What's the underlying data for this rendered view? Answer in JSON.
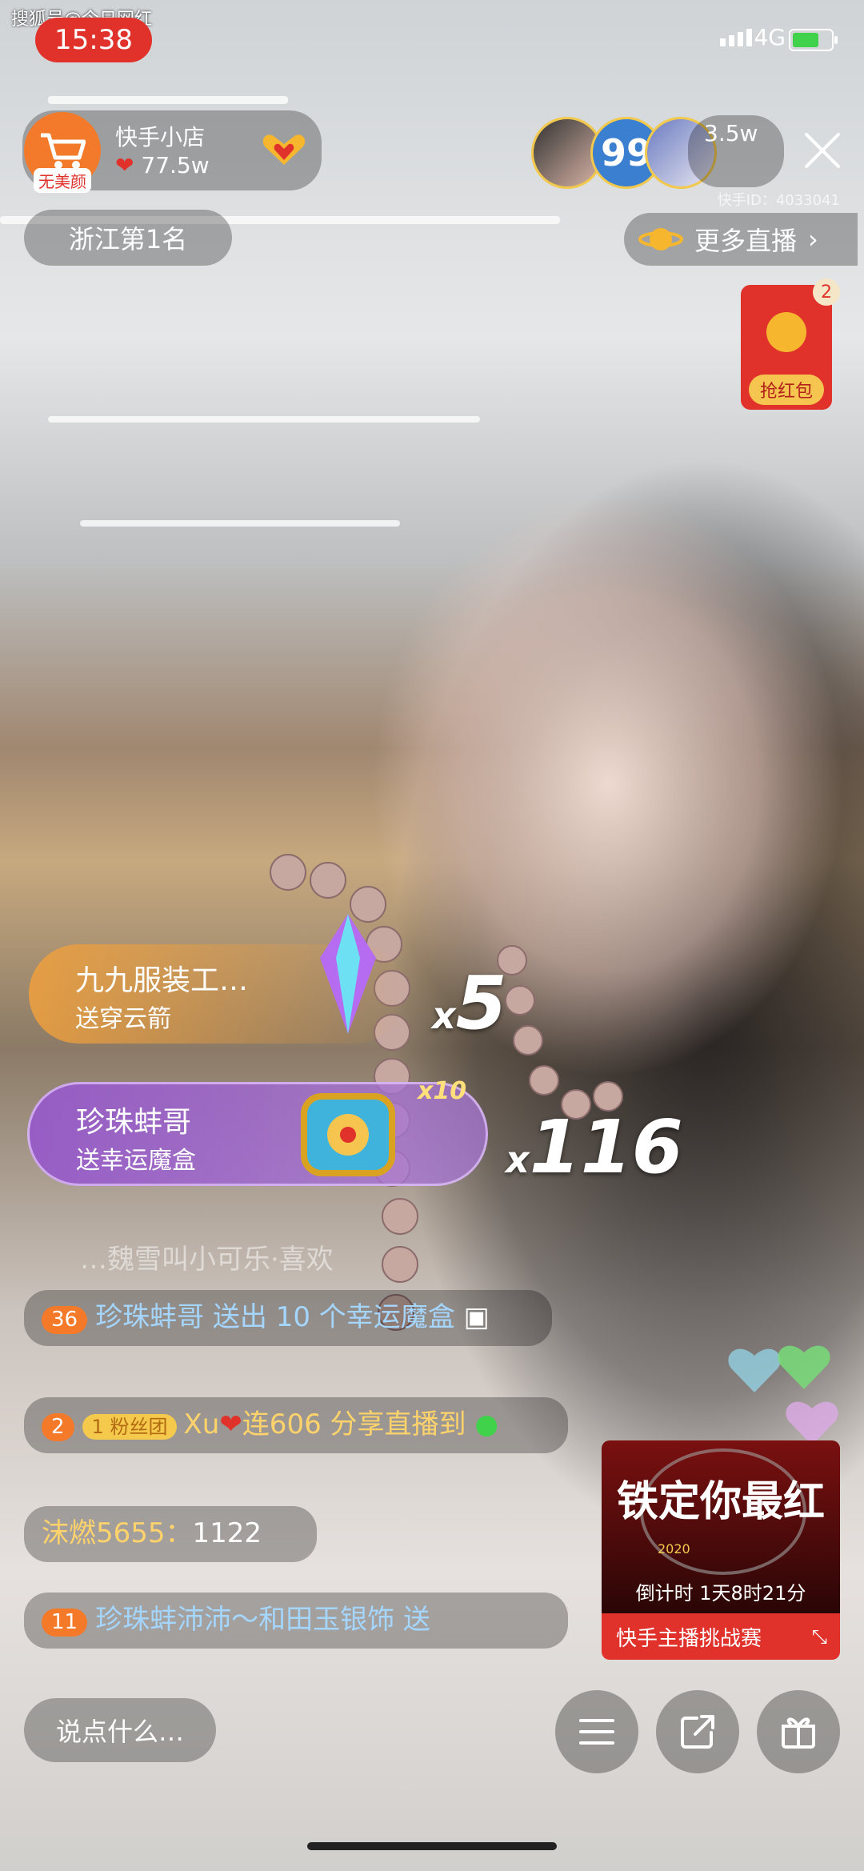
{
  "watermark": "搜狐号@今日网红",
  "status_bar": {
    "time": "15:38",
    "network": "4G",
    "battery_level": 0.7,
    "colors": {
      "time_bg": "#e0322b",
      "battery_fill": "#3fd24a"
    }
  },
  "anchor": {
    "shop_name": "快手小店",
    "avatar_badge": "无美颜",
    "likes": "77.5w",
    "rank": "浙江第1名"
  },
  "viewers": {
    "count": "3.5w",
    "badge_number": "99"
  },
  "kuaishou_id": "快手ID：4033041",
  "more_live": "更多直播",
  "red_packet": {
    "label": "抢红包",
    "count": "2"
  },
  "gifts": [
    {
      "sender": "九九服装工…",
      "action": "送穿云箭",
      "combo_x": "x",
      "combo": "5"
    },
    {
      "sender": "珍珠蚌哥",
      "action": "送幸运魔盒",
      "multiplier": "x10",
      "combo_x": "x",
      "combo": "116"
    }
  ],
  "faded_comment": "…魏雪叫小可乐·喜欢",
  "comments": [
    {
      "level": "36",
      "user": "珍珠蚌哥",
      "text": "送出 10 个幸运魔盒"
    },
    {
      "level": "2",
      "fan_level": "1",
      "fan_label": "粉丝团",
      "user": "Xu",
      "text": "连606 分享直播到"
    },
    {
      "user": "沫燃5655：",
      "text": "1122"
    },
    {
      "level": "11",
      "user": "珍珠蚌沛沛～和田玉银饰",
      "text": "送"
    }
  ],
  "challenge": {
    "title": "铁定你最红",
    "year": "2020",
    "countdown": "倒计时 1天8时21分",
    "banner": "快手主播挑战赛"
  },
  "bottom_bar": {
    "input_placeholder": "说点什么…",
    "menu_icon": "menu-icon",
    "share_icon": "share-icon",
    "gift_icon": "gift-icon"
  }
}
